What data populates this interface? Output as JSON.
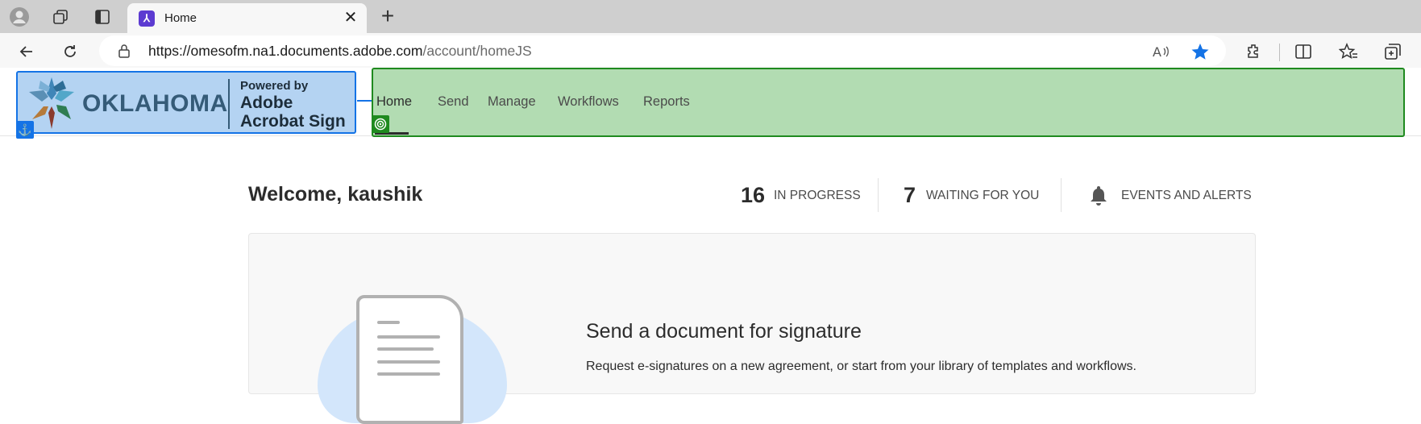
{
  "browser": {
    "tab_title": "Home",
    "tab_close": "✕",
    "new_tab": "+",
    "url_host": "https://omesofm.na1.documents.adobe.com",
    "url_path": "/account/homeJS"
  },
  "header": {
    "logo": {
      "state_text": "OKLAHOMA",
      "powered_by": "Powered by",
      "product_line1": "Adobe",
      "product_line2": "Acrobat Sign"
    },
    "nav": [
      "Home",
      "Send",
      "Manage",
      "Workflows",
      "Reports"
    ],
    "active_nav": "Home"
  },
  "main": {
    "welcome": "Welcome, kaushik",
    "stats": [
      {
        "count": "16",
        "label": "IN PROGRESS"
      },
      {
        "count": "7",
        "label": "WAITING FOR YOU"
      }
    ],
    "alerts_label": "EVENTS AND ALERTS",
    "card": {
      "title": "Send a document for signature",
      "text": "Request e-signatures on a new agreement, or start from your library of templates and workflows."
    }
  },
  "colors": {
    "logo_highlight": "#b4d3f2",
    "logo_border": "#1473e6",
    "nav_highlight": "#b2dcb2",
    "nav_border": "#1f8a1f",
    "favorite_star": "#1473e6"
  },
  "icons": [
    "profile-icon",
    "workspaces-icon",
    "tab-actions-icon",
    "acrobat-favicon",
    "back-icon",
    "refresh-icon",
    "lock-icon",
    "read-aloud-icon",
    "favorite-star-icon",
    "extensions-icon",
    "split-screen-icon",
    "favorites-icon",
    "collections-icon",
    "anchor-icon",
    "target-icon",
    "bell-icon",
    "document-icon"
  ]
}
